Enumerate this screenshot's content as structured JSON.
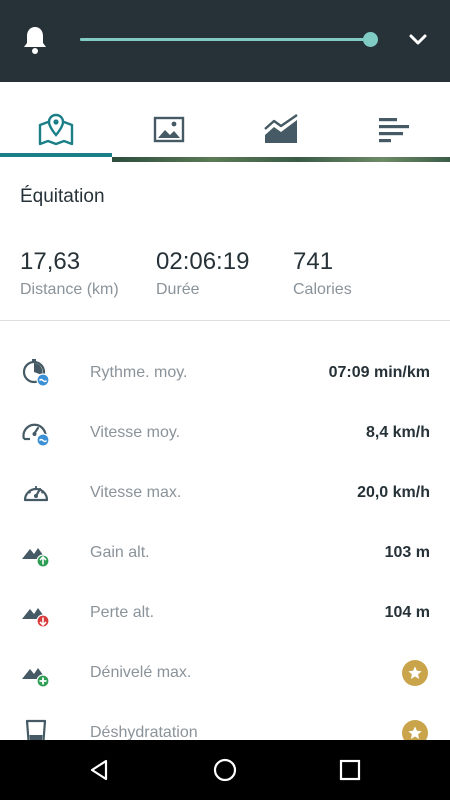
{
  "header": {
    "slider_level_percent": 100,
    "colors": {
      "bar": "#263238",
      "accent": "#80cbc4"
    }
  },
  "tabs": [
    {
      "icon": "map-icon",
      "selected": true
    },
    {
      "icon": "image-icon",
      "selected": false
    },
    {
      "icon": "chart-icon",
      "selected": false
    },
    {
      "icon": "list-icon",
      "selected": false
    }
  ],
  "activity": {
    "title": "Équitation"
  },
  "summary": [
    {
      "value": "17,63",
      "label": "Distance (km)"
    },
    {
      "value": "02:06:19",
      "label": "Durée"
    },
    {
      "value": "741",
      "label": "Calories"
    }
  ],
  "stats": [
    {
      "icon": "pace-icon",
      "label": "Rythme. moy.",
      "value": "07:09 min/km"
    },
    {
      "icon": "avg-speed-icon",
      "label": "Vitesse moy.",
      "value": "8,4 km/h"
    },
    {
      "icon": "speedometer-icon",
      "label": "Vitesse max.",
      "value": "20,0 km/h"
    },
    {
      "icon": "elevation-gain-icon",
      "label": "Gain alt.",
      "value": "103 m"
    },
    {
      "icon": "elevation-loss-icon",
      "label": "Perte alt.",
      "value": "104 m"
    },
    {
      "icon": "max-elevation-icon",
      "label": "Dénivelé max.",
      "value": "",
      "premium": true
    },
    {
      "icon": "dehydration-icon",
      "label": "Déshydratation",
      "value": "",
      "premium": true
    }
  ],
  "navigation": [
    "back-icon",
    "home-icon",
    "recents-icon"
  ]
}
